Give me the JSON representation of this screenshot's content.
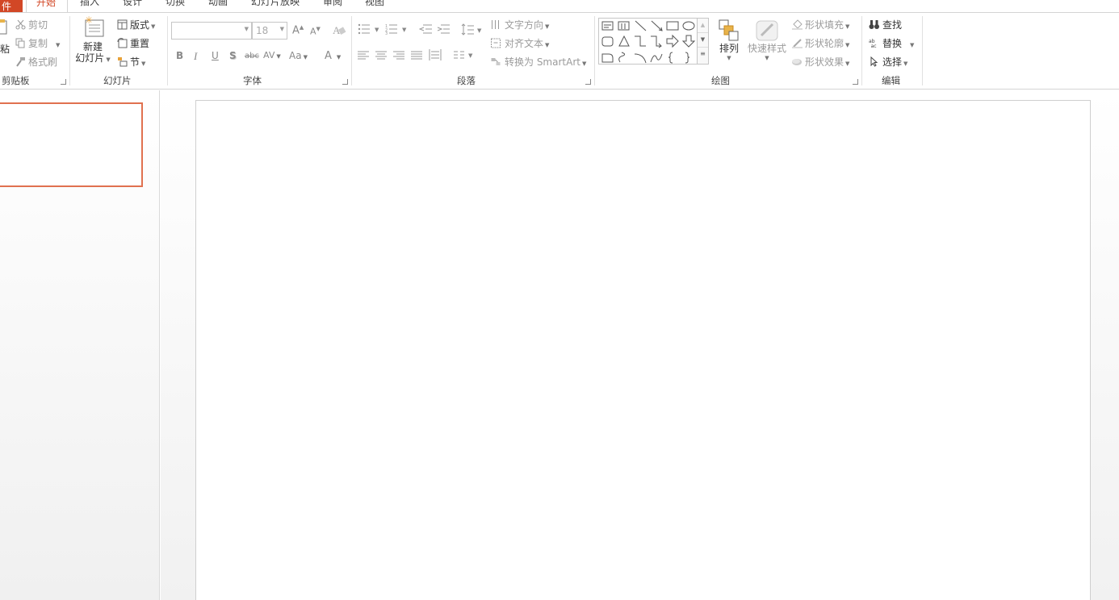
{
  "tabs": {
    "file": "件",
    "home": "开始",
    "insert": "插入",
    "design": "设计",
    "transitions": "切换",
    "animations": "动画",
    "slideshow": "幻灯片放映",
    "review": "审阅",
    "view": "视图"
  },
  "clipboard": {
    "paste": "粘",
    "cut": "剪切",
    "copy": "复制",
    "format_painter": "格式刷",
    "label": "剪贴板"
  },
  "slides": {
    "new_slide_line1": "新建",
    "new_slide_line2": "幻灯片",
    "layout": "版式",
    "reset": "重置",
    "section": "节",
    "label": "幻灯片"
  },
  "font": {
    "font_name": "",
    "font_size": "18",
    "grow": "A",
    "shrink": "A",
    "bold": "B",
    "italic": "I",
    "underline": "U",
    "shadow": "S",
    "strike": "abc",
    "spacing": "AV",
    "change_case": "Aa",
    "color": "A",
    "label": "字体"
  },
  "paragraph": {
    "text_direction": "文字方向",
    "align_text": "对齐文本",
    "convert_smartart": "转换为 SmartArt",
    "label": "段落"
  },
  "drawing": {
    "arrange": "排列",
    "quick_styles": "快速样式",
    "shape_fill": "形状填充",
    "shape_outline": "形状轮廓",
    "shape_effects": "形状效果",
    "label": "绘图"
  },
  "editing": {
    "find": "查找",
    "replace": "替换",
    "select": "选择",
    "label": "编辑"
  },
  "colors": {
    "accent": "#d24726",
    "thumb_border": "#e0714f"
  }
}
